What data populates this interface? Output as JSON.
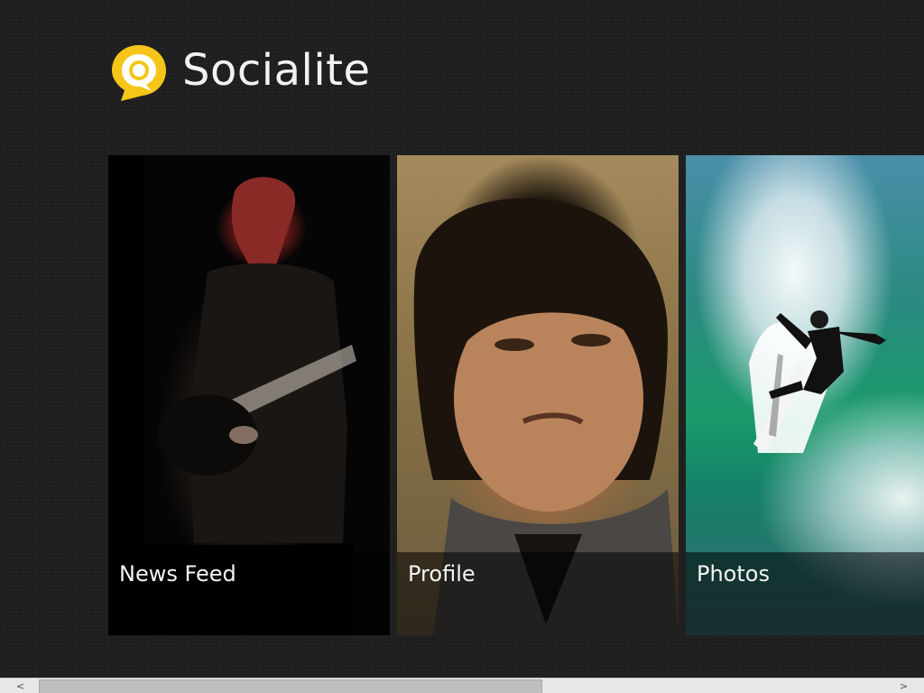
{
  "app": {
    "title": "Socialite",
    "logo_icon": "speech-bubble-icon",
    "accent_color": "#f5c518"
  },
  "tiles": [
    {
      "label": "News Feed",
      "image": "guitarist-photo"
    },
    {
      "label": "Profile",
      "image": "portrait-photo"
    },
    {
      "label": "Photos",
      "image": "surfer-photo"
    }
  ],
  "scrollbar": {
    "left_arrow": "<",
    "right_arrow": ">"
  }
}
